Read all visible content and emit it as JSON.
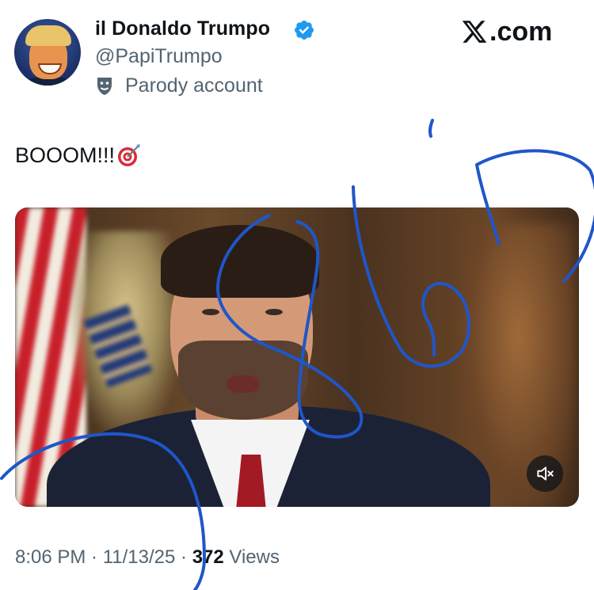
{
  "author": {
    "display_name": "il Donaldo Trumpo",
    "handle": "@PapiTrumpo",
    "label": "Parody account",
    "verified": true
  },
  "brand": {
    "domain_text": ".com"
  },
  "post": {
    "text": "BOOOM!!!"
  },
  "video": {
    "muted": true
  },
  "meta": {
    "time": "8:06 PM",
    "sep1": " · ",
    "date": "11/13/25",
    "sep2": " · ",
    "views_count": "372",
    "views_label": " Views"
  },
  "colors": {
    "text": "#0f1419",
    "secondary": "#536471",
    "verified_blue": "#1d9bf0",
    "scribble_blue": "#1f56c9"
  },
  "icons": [
    "verified-badge-icon",
    "theater-masks-icon",
    "x-logo-icon",
    "direct-hit-icon",
    "mute-icon"
  ]
}
